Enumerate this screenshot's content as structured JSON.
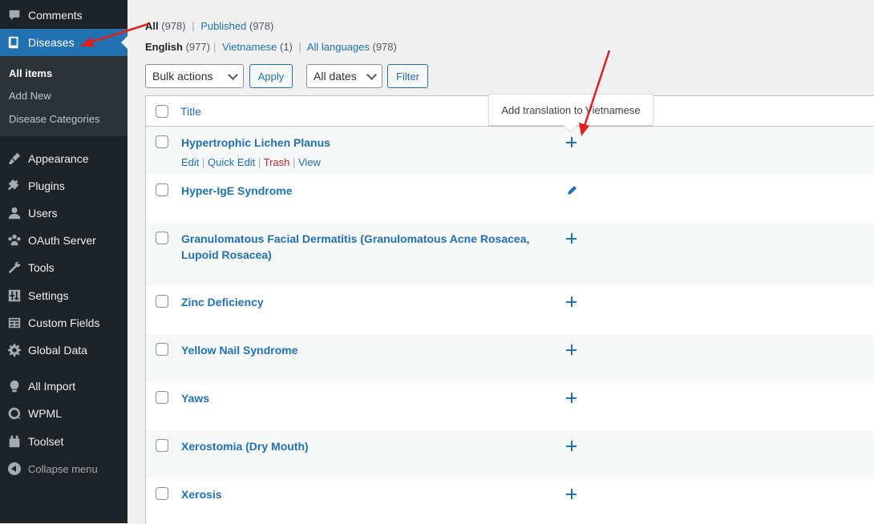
{
  "sidebar": {
    "menu": [
      {
        "label": "Comments",
        "icon": "comments-icon"
      },
      {
        "label": "Diseases",
        "icon": "book-icon",
        "active": true
      },
      {
        "label": "Appearance",
        "icon": "brush-icon"
      },
      {
        "label": "Plugins",
        "icon": "plug-icon"
      },
      {
        "label": "Users",
        "icon": "user-icon"
      },
      {
        "label": "OAuth Server",
        "icon": "group-icon"
      },
      {
        "label": "Tools",
        "icon": "wrench-icon"
      },
      {
        "label": "Settings",
        "icon": "settings-icon"
      },
      {
        "label": "Custom Fields",
        "icon": "table-icon"
      },
      {
        "label": "Global Data",
        "icon": "gear-icon"
      },
      {
        "label": "All Import",
        "icon": "import-icon"
      },
      {
        "label": "WPML",
        "icon": "wpml-icon"
      },
      {
        "label": "Toolset",
        "icon": "toolset-icon"
      }
    ],
    "submenu": [
      "All items",
      "Add New",
      "Disease Categories"
    ],
    "collapse_label": "Collapse menu"
  },
  "filters": {
    "status": {
      "all_label": "All",
      "all_count": "(978)",
      "published_label": "Published",
      "published_count": "(978)"
    },
    "languages": {
      "english_label": "English",
      "english_count": "(977)",
      "vietnamese_label": "Vietnamese",
      "vietnamese_count": "(1)",
      "all_label": "All languages",
      "all_count": "(978)"
    },
    "bulk_actions": "Bulk actions",
    "apply": "Apply",
    "dates": "All dates",
    "filter": "Filter"
  },
  "table": {
    "column_title": "Title",
    "rows": [
      {
        "title": "Hypertrophic Lichen Planus",
        "icon": "plus-icon"
      },
      {
        "title": "Hyper-IgE Syndrome",
        "icon": "pencil-icon"
      },
      {
        "title": "Granulomatous Facial Dermatitis (Granulomatous Acne Rosacea, Lupoid Rosacea)",
        "icon": "plus-icon"
      },
      {
        "title": "Zinc Deficiency",
        "icon": "plus-icon"
      },
      {
        "title": "Yellow Nail Syndrome",
        "icon": "plus-icon"
      },
      {
        "title": "Yaws",
        "icon": "plus-icon"
      },
      {
        "title": "Xerostomia (Dry Mouth)",
        "icon": "plus-icon"
      },
      {
        "title": "Xerosis",
        "icon": "plus-icon"
      }
    ],
    "row_actions": {
      "edit": "Edit",
      "quick_edit": "Quick Edit",
      "trash": "Trash",
      "view": "View"
    }
  },
  "tooltip": "Add translation to Vietnamese",
  "colors": {
    "sidebar": "#1d2327",
    "accent": "#2271b1",
    "annotation": "#e11d1d"
  }
}
